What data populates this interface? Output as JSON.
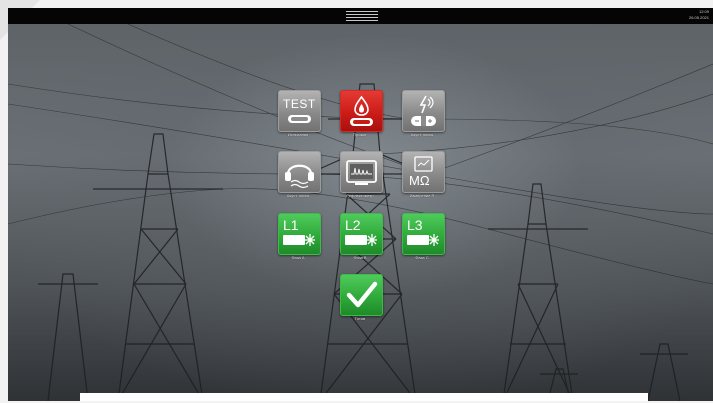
{
  "status_bar": {
    "time": "12:09",
    "date": "26.05.2021"
  },
  "tiles": [
    {
      "label": "Испытания",
      "icon": "test-plug-icon",
      "text": "TEST",
      "color": "#8c8c8c"
    },
    {
      "label": "Прожиг",
      "icon": "burn-flame-icon",
      "color": "#d01f1a"
    },
    {
      "label": "Акуст. поиск",
      "icon": "acoustic-pulse-icon",
      "color": "#8c8c8c"
    },
    {
      "label": "Акуст. поиск",
      "icon": "headphones-icon",
      "color": "#8c8c8c"
    },
    {
      "label": "Рефлектометр",
      "icon": "reflectometer-icon",
      "color": "#8c8c8c"
    },
    {
      "label": "Измерение R",
      "icon": "megaohm-icon",
      "text": "MΩ",
      "color": "#8c8c8c"
    },
    {
      "label": "Фаза А",
      "icon": "phase-l1-icon",
      "text": "L1",
      "color": "#34b23f"
    },
    {
      "label": "Фаза B",
      "icon": "phase-l2-icon",
      "text": "L2",
      "color": "#34b23f"
    },
    {
      "label": "Фаза C",
      "icon": "phase-l3-icon",
      "text": "L3",
      "color": "#34b23f"
    },
    {
      "label": "Готов",
      "icon": "check-icon",
      "color": "#34b23f"
    }
  ]
}
